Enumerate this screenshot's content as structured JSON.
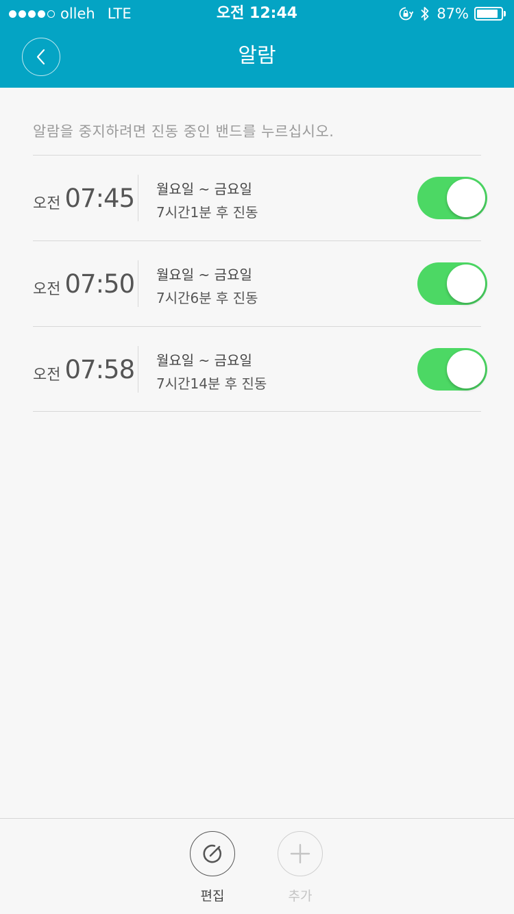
{
  "status_bar": {
    "carrier": "olleh",
    "network": "LTE",
    "time": "오전 12:44",
    "battery_percent": "87%",
    "battery_level": 0.87,
    "signal_bars_filled": 4,
    "signal_bars_total": 5,
    "icons": [
      "orientation-lock-icon",
      "bluetooth-icon",
      "battery-icon"
    ]
  },
  "nav": {
    "title": "알람",
    "back_icon": "chevron-left-icon"
  },
  "hint": "알람을 중지하려면 진동 중인 밴드를 누르십시오.",
  "alarms": [
    {
      "ampm": "오전",
      "time": "07:45",
      "days": "월요일 ~ 금요일",
      "remaining": "7시간1분 후 진동",
      "enabled": true
    },
    {
      "ampm": "오전",
      "time": "07:50",
      "days": "월요일 ~ 금요일",
      "remaining": "7시간6분 후 진동",
      "enabled": true
    },
    {
      "ampm": "오전",
      "time": "07:58",
      "days": "월요일 ~ 금요일",
      "remaining": "7시간14분 후 진동",
      "enabled": true
    }
  ],
  "toolbar": {
    "edit_label": "편집",
    "add_label": "추가",
    "edit_icon": "edit-icon",
    "add_icon": "plus-icon"
  },
  "colors": {
    "header_bg": "#04a4c4",
    "toggle_on": "#4cd864",
    "page_bg": "#f7f7f7"
  }
}
